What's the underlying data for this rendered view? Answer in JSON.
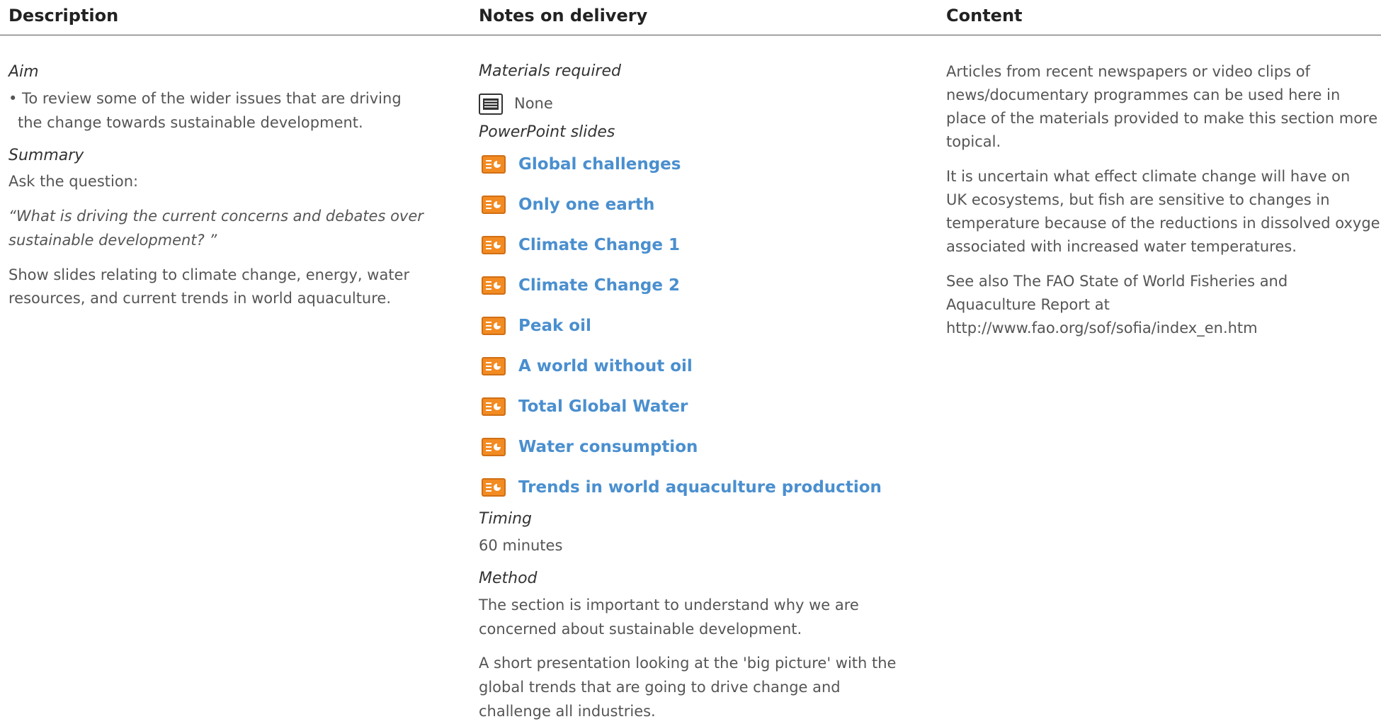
{
  "headers": {
    "description": "Description",
    "notes": "Notes on delivery",
    "content": "Content"
  },
  "description": {
    "aim_heading": "Aim",
    "aim_bullet_line1": "• To review some of the wider issues that are driving",
    "aim_bullet_line2": "the change towards sustainable development.",
    "summary_heading": "Summary",
    "ask": "Ask the question:",
    "question_line1": "“What is driving the current concerns and debates over",
    "question_line2": "sustainable development? ”",
    "show_line1": "Show slides relating to climate change, energy, water",
    "show_line2": "resources, and current trends in world aquaculture."
  },
  "notes": {
    "materials_heading": "Materials required",
    "materials_value": "None",
    "materials_icon": "document-icon",
    "slides_heading": "PowerPoint slides",
    "slide_icon": "powerpoint-slide-icon",
    "slides": [
      "Global challenges",
      "Only one earth",
      "Climate Change 1",
      "Climate Change 2",
      "Peak oil",
      "A world without oil",
      "Total Global Water",
      "Water consumption",
      "Trends in world aquaculture production"
    ],
    "timing_heading": "Timing",
    "timing_value": "60 minutes",
    "method_heading": "Method",
    "method_p1_line1": "The section is important to understand why we are",
    "method_p1_line2": "concerned about sustainable development.",
    "method_p2_line1": "A short presentation looking at the 'big picture' with the",
    "method_p2_line2": "global trends that are going to drive change and",
    "method_p2_line3": "challenge all industries."
  },
  "content": {
    "p1_line1": "Articles from recent newspapers or video clips of",
    "p1_line2": "news/documentary programmes can be used here in",
    "p1_line3": "place of the materials provided to make this section more",
    "p1_line4": "topical.",
    "p2_line1": "It is uncertain what effect climate change will have on",
    "p2_line2": "UK ecosystems, but fish are sensitive to changes in",
    "p2_line3": "temperature because of the reductions in dissolved oxygen",
    "p2_line4": "associated with increased water temperatures.",
    "p3_line1": "See also The FAO State of World Fisheries and",
    "p3_line2": "Aquaculture Report at",
    "p3_line3": "http://www.fao.org/sof/sofia/index_en.htm"
  },
  "colors": {
    "link": "#4a8fcf",
    "slide_icon_fill": "#f28b22",
    "rule": "#555555"
  }
}
